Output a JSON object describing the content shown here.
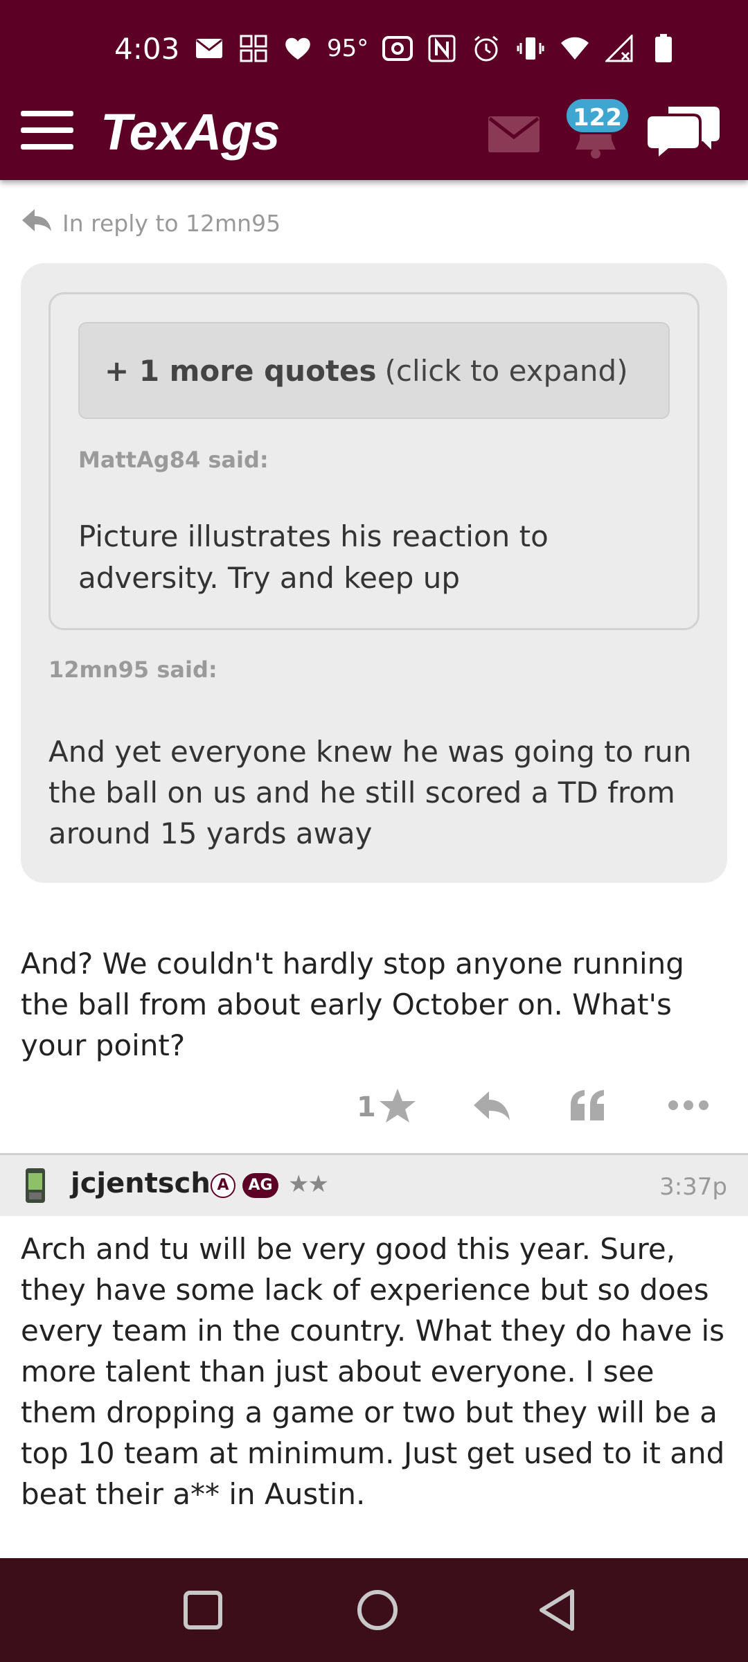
{
  "status_bar": {
    "time": "4:03",
    "temperature": "95°"
  },
  "header": {
    "logo": "TexAgs",
    "notification_count": "122"
  },
  "thread": {
    "reply_label": "In reply to 12mn95",
    "expand_bold": "+ 1 more quotes",
    "expand_rest": "(click to expand)",
    "inner_quote_author": "MattAg84 said:",
    "inner_quote_text": "Picture illustrates his reaction to adversity. Try and keep up",
    "outer_quote_author": "12mn95 said:",
    "outer_quote_text": "And yet everyone knew he was going to run the ball on us and he still scored a TD from around 15 yards away",
    "reply_text": "And? We couldn't hardly stop anyone running the ball from about early October on. What's your point?",
    "like_count": "1"
  },
  "next_post": {
    "username": "jcjentsch",
    "badge_a": "A",
    "badge_ag": "AG",
    "stars": "★★",
    "time": "3:37p",
    "text": "Arch and tu will be very good this year. Sure, they have some lack of experience but so does every team in the country. What they do have is more talent than just about everyone. I see them dropping a game or two but they will be a top 10 team at minimum. Just get used to it and beat their a** in Austin."
  },
  "colors": {
    "brand": "#5c0025",
    "badge_blue": "#3fa6d1",
    "nav_bar": "#3b0e1a"
  }
}
